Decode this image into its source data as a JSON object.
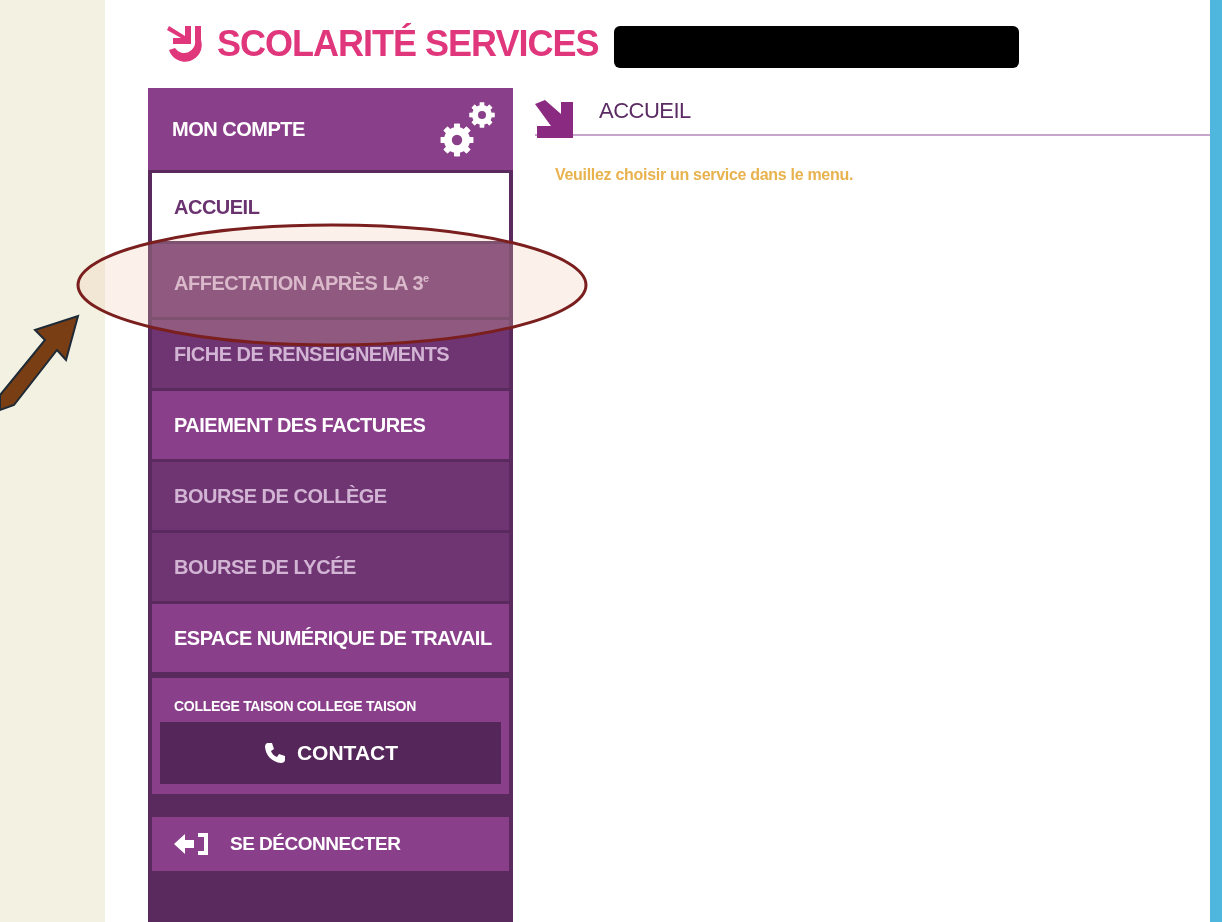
{
  "header": {
    "logo_text": "SCOLARITÉ SERVICES"
  },
  "sidebar": {
    "account": {
      "label": "MON COMPTE"
    },
    "items": [
      {
        "label": "ACCUEIL",
        "selected": true,
        "disabled": false
      },
      {
        "label": "AFFECTATION APRÈS LA 3$^{e}$",
        "selected": false,
        "disabled": true
      },
      {
        "label": "FICHE DE RENSEIGNEMENTS",
        "selected": false,
        "disabled": true
      },
      {
        "label": "PAIEMENT DES FACTURES",
        "selected": false,
        "disabled": false
      },
      {
        "label": "BOURSE DE COLLÈGE",
        "selected": false,
        "disabled": true
      },
      {
        "label": "BOURSE DE LYCÉE",
        "selected": false,
        "disabled": true
      },
      {
        "label": "ESPACE NUMÉRIQUE DE TRAVAIL",
        "selected": false,
        "disabled": false
      }
    ],
    "school": {
      "name": "COLLEGE TAISON COLLEGE TAISON",
      "contact_button": "CONTACT"
    },
    "logout": {
      "label": "SE DÉCONNECTER"
    }
  },
  "main": {
    "title": "ACCUEIL",
    "message": "Veuillez choisir un service dans le menu."
  }
}
